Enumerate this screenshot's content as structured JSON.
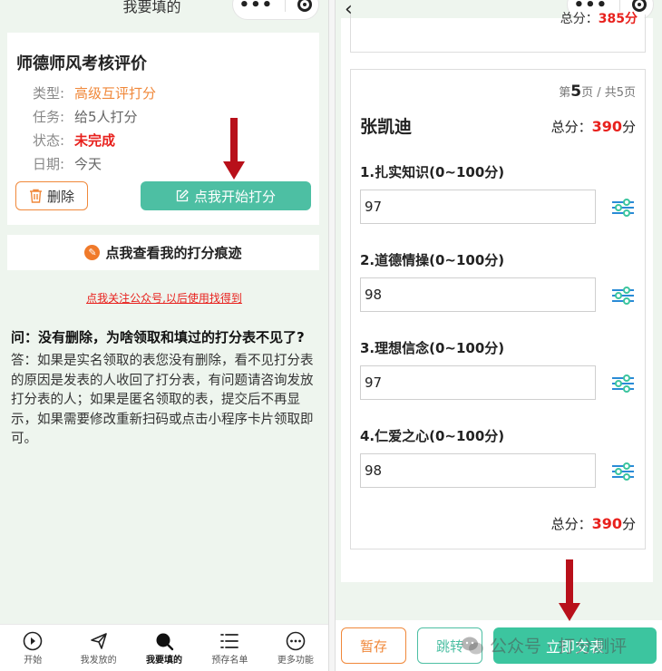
{
  "left": {
    "header_title": "我要填的",
    "card": {
      "title": "师德师风考核评价",
      "rows": [
        {
          "key": "类型:",
          "value": "高级互评打分"
        },
        {
          "key": "任务:",
          "value": "给5人打分"
        },
        {
          "key": "状态:",
          "value": "未完成"
        },
        {
          "key": "日期:",
          "value": "今天"
        }
      ],
      "delete_label": "删除",
      "start_label": "点我开始打分"
    },
    "trace_label": "点我查看我的打分痕迹",
    "follow_link": "点我关注公众号,以后使用找得到",
    "faq_question": "问：没有删除，为啥领取和填过的打分表不见了?",
    "faq_answer": "答：如果是实名领取的表您没有删除，看不见打分表的原因是发表的人收回了打分表，有问题请咨询发放打分表的人；如果是匿名领取的表，提交后不再显示，如果需要修改重新扫码或点击小程序卡片领取即可。",
    "tabs": [
      {
        "label": "开始"
      },
      {
        "label": "我发放的"
      },
      {
        "label": "我要填的"
      },
      {
        "label": "预存名单"
      },
      {
        "label": "更多功能"
      }
    ]
  },
  "right": {
    "prev_total_label": "总分：",
    "prev_total_value": "385分",
    "page_prefix": "第",
    "page_current": "5",
    "page_suffix": "页 / 共5页",
    "person_name": "张凯迪",
    "total_label": "总分：",
    "total_value": "390",
    "total_unit": "分",
    "questions": [
      {
        "label": "1.扎实知识(0~100分)",
        "value": "97"
      },
      {
        "label": "2.道德情操(0~100分)",
        "value": "98"
      },
      {
        "label": "3.理想信念(0~100分)",
        "value": "97"
      },
      {
        "label": "4.仁爱之心(0~100分)",
        "value": "98"
      }
    ],
    "save_label": "暂存",
    "jump_label": "跳转",
    "submit_label": "立即交表",
    "watermark_text": "公众号 · 打分测评"
  },
  "colors": {
    "accent_green": "#4dbfa3",
    "accent_orange": "#f0883a",
    "alert_red": "#e8211d",
    "arrow_red": "#b8101a"
  }
}
